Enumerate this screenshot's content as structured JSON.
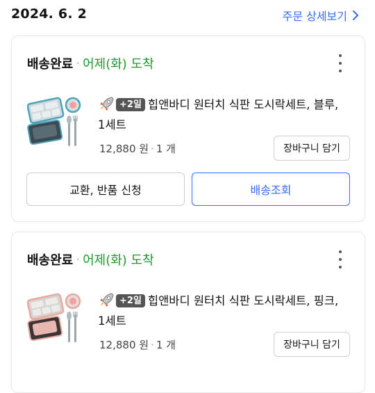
{
  "header": {
    "date": "2024. 6. 2",
    "detail_link": "주문 상세보기"
  },
  "orders": [
    {
      "status": "배송완료",
      "separator": "·",
      "arrival": "어제(화) 도착",
      "badge": "+2일",
      "product_name": "힙앤바디 원터치 식판 도시락세트, 블루, 1세트",
      "price": "12,880 원",
      "quantity": "1 개",
      "cart_button": "장바구니 담기",
      "exchange_button": "교환, 반품 신청",
      "tracking_button": "배송조회",
      "accent_color": "#4aa3b8"
    },
    {
      "status": "배송완료",
      "separator": "·",
      "arrival": "어제(화) 도착",
      "badge": "+2일",
      "product_name": "힙앤바디 원터치 식판 도시락세트, 핑크, 1세트",
      "price": "12,880 원",
      "quantity": "1 개",
      "cart_button": "장바구니 담기",
      "accent_color": "#e8a9a0"
    }
  ],
  "colors": {
    "link_blue": "#346aff",
    "arrival_green": "#1a9a2b"
  },
  "icons": [
    "chevron-right-icon",
    "more-vertical-icon",
    "rocket-icon"
  ]
}
